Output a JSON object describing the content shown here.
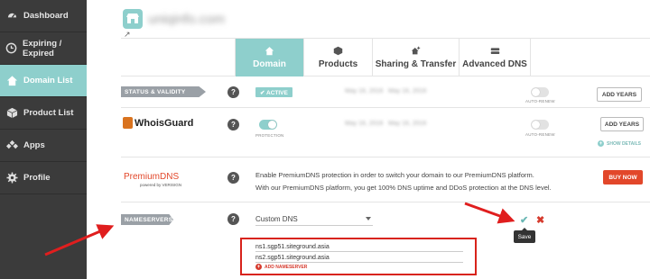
{
  "sidebar": {
    "items": [
      {
        "label": "Dashboard",
        "icon": "dashboard-icon",
        "active": false
      },
      {
        "label": "Expiring / Expired",
        "icon": "clock-icon",
        "active": false
      },
      {
        "label": "Domain List",
        "icon": "home-icon",
        "active": true
      },
      {
        "label": "Product List",
        "icon": "box-icon",
        "active": false
      },
      {
        "label": "Apps",
        "icon": "apps-icon",
        "active": false
      },
      {
        "label": "Profile",
        "icon": "gear-icon",
        "active": false
      }
    ]
  },
  "header": {
    "domain_name": "uniqinfo.com"
  },
  "tabs": [
    {
      "label": "Domain",
      "icon": "home-icon",
      "active": true
    },
    {
      "label": "Products",
      "icon": "box-icon",
      "active": false
    },
    {
      "label": "Sharing & Transfer",
      "icon": "user-plus-icon",
      "active": false
    },
    {
      "label": "Advanced DNS",
      "icon": "server-icon",
      "active": false
    }
  ],
  "status": {
    "label": "STATUS & VALIDITY",
    "badge": "✔ ACTIVE",
    "date_from": "May 16, 2016",
    "date_to": "May 16, 2016",
    "autorenew_label": "AUTO-RENEW",
    "button": "ADD YEARS"
  },
  "whoisguard": {
    "name": "WhoisGuard",
    "protection_label": "PROTECTION",
    "date_from": "May 16, 2016",
    "date_to": "May 16, 2016",
    "autorenew_label": "AUTO-RENEW",
    "button": "ADD YEARS",
    "show_details": "SHOW DETAILS"
  },
  "premiumdns": {
    "name": "PremiumDNS",
    "sub": "powered by VERISIGN",
    "desc_line1": "Enable PremiumDNS protection in order to switch your domain to our PremiumDNS platform.",
    "desc_line2": "With our PremiumDNS platform, you get 100% DNS uptime and DDoS protection at the DNS level.",
    "button": "BUY NOW"
  },
  "nameservers": {
    "label": "NAMESERVERS",
    "selected": "Custom DNS",
    "entries": [
      "ns1.sgp51.siteground.asia",
      "ns2.sgp51.siteground.asia"
    ],
    "add_label": "ADD NAMESERVER",
    "save_tooltip": "Save"
  },
  "colors": {
    "accent": "#8ecfcc",
    "sidebar": "#3b3b3b",
    "danger": "#e2472a",
    "highlight_red": "#d8231b"
  }
}
